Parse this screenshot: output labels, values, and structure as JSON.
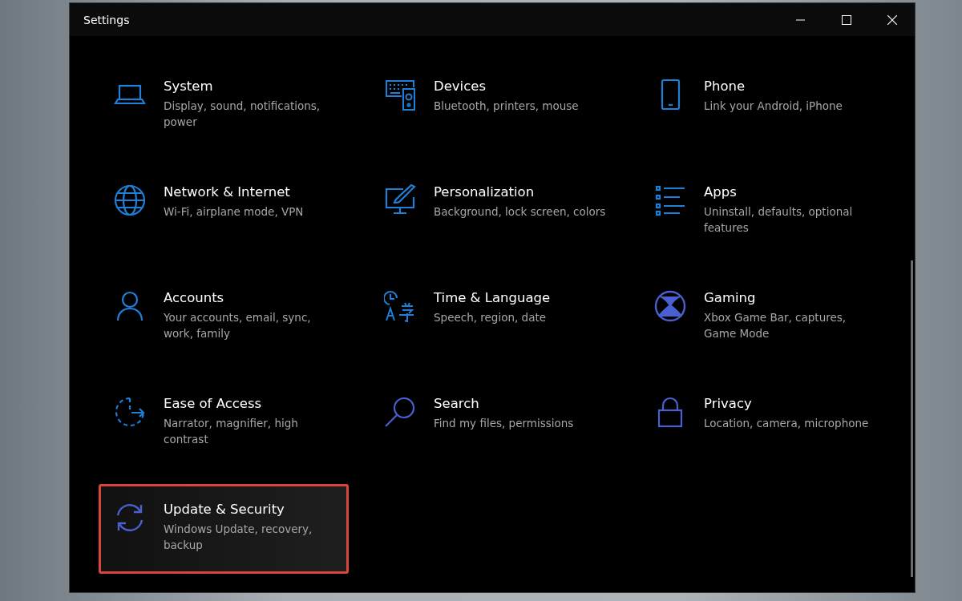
{
  "window": {
    "title": "Settings"
  },
  "categories": [
    {
      "kind": "laptop",
      "title": "System",
      "subtitle": "Display, sound, notifications, power",
      "highlighted": false
    },
    {
      "kind": "devices",
      "title": "Devices",
      "subtitle": "Bluetooth, printers, mouse",
      "highlighted": false
    },
    {
      "kind": "phone",
      "title": "Phone",
      "subtitle": "Link your Android, iPhone",
      "highlighted": false
    },
    {
      "kind": "globe",
      "title": "Network & Internet",
      "subtitle": "Wi-Fi, airplane mode, VPN",
      "highlighted": false
    },
    {
      "kind": "paint",
      "title": "Personalization",
      "subtitle": "Background, lock screen, colors",
      "highlighted": false
    },
    {
      "kind": "list",
      "title": "Apps",
      "subtitle": "Uninstall, defaults, optional features",
      "highlighted": false
    },
    {
      "kind": "person",
      "title": "Accounts",
      "subtitle": "Your accounts, email, sync, work, family",
      "highlighted": false
    },
    {
      "kind": "language",
      "title": "Time & Language",
      "subtitle": "Speech, region, date",
      "highlighted": false
    },
    {
      "kind": "xbox",
      "title": "Gaming",
      "subtitle": "Xbox Game Bar, captures, Game Mode",
      "highlighted": false
    },
    {
      "kind": "ease",
      "title": "Ease of Access",
      "subtitle": "Narrator, magnifier, high contrast",
      "highlighted": false
    },
    {
      "kind": "search",
      "title": "Search",
      "subtitle": "Find my files, permissions",
      "highlighted": false
    },
    {
      "kind": "lock",
      "title": "Privacy",
      "subtitle": "Location, camera, microphone",
      "highlighted": false
    },
    {
      "kind": "sync",
      "title": "Update & Security",
      "subtitle": "Windows Update, recovery, backup",
      "highlighted": true
    }
  ]
}
